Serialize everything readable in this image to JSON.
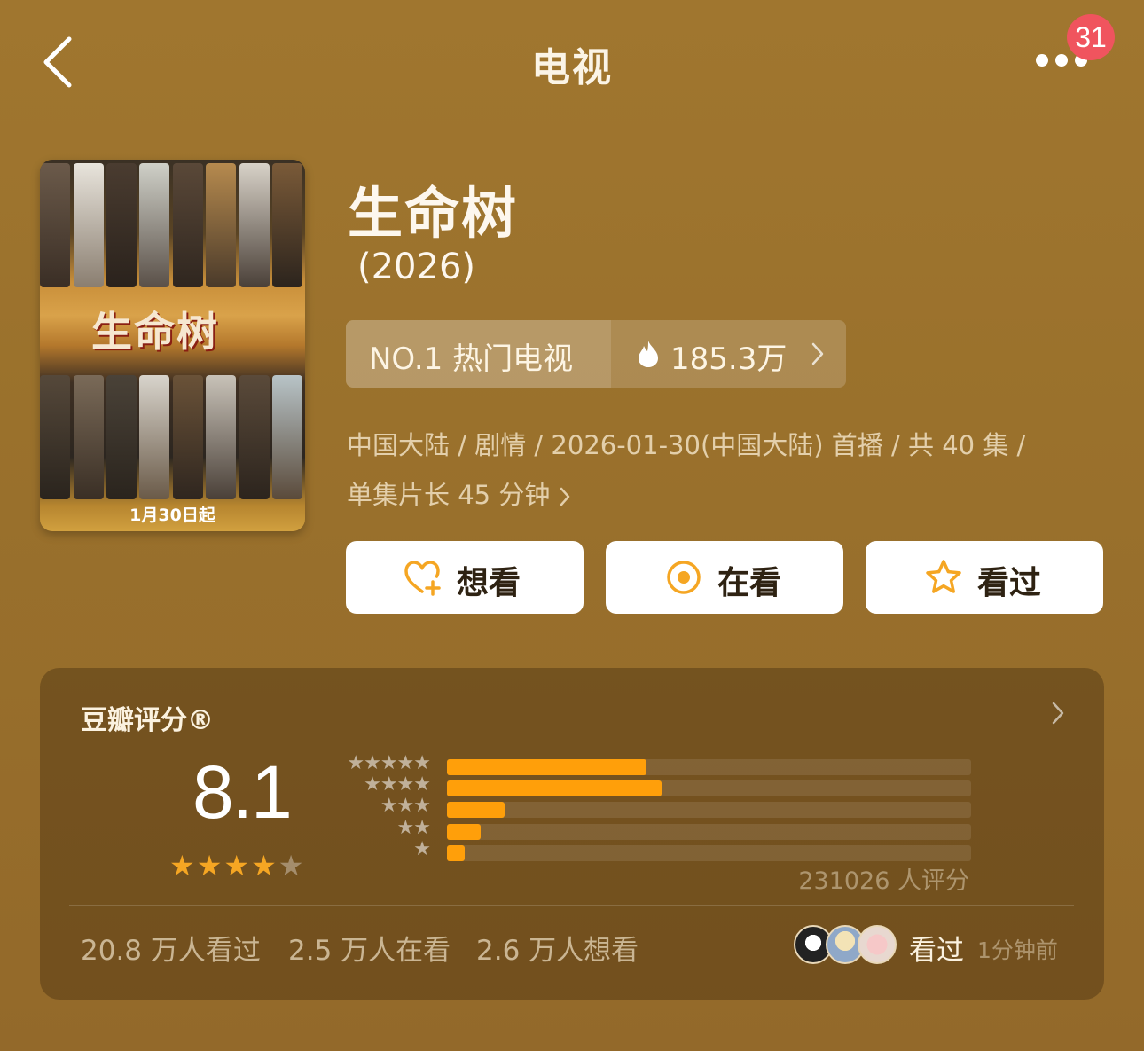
{
  "nav": {
    "title": "电视",
    "badge": "31"
  },
  "poster": {
    "title": "生命树",
    "date": "1月30日起"
  },
  "show": {
    "title": "生命树",
    "year": "(2026)"
  },
  "rank": {
    "label": "NO.1 热门电视",
    "heat": "185.3万"
  },
  "meta": {
    "line1": "中国大陆 / 剧情 / 2026-01-30(中国大陆) 首播 / 共 40 集 /",
    "line2": "单集片长 45 分钟"
  },
  "actions": {
    "want": "想看",
    "watching": "在看",
    "watched": "看过"
  },
  "rating": {
    "title": "豆瓣评分®",
    "score": "8.1",
    "stars": 4,
    "votes": "231026 人评分",
    "distribution": [
      {
        "stars": "★★★★★",
        "fraction": 0.38
      },
      {
        "stars": "★★★★",
        "fraction": 0.41
      },
      {
        "stars": "★★★",
        "fraction": 0.11
      },
      {
        "stars": "★★",
        "fraction": 0.065
      },
      {
        "stars": "★",
        "fraction": 0.033
      }
    ],
    "stats": {
      "watched": "20.8 万人看过",
      "watching": "2.5 万人在看",
      "want": "2.6 万人想看"
    },
    "friend_status": "看过",
    "friend_time": "1分钟前"
  },
  "colors": {
    "accent": "#ff9f0a",
    "badge": "#f0545e",
    "background": "#9a712c"
  }
}
